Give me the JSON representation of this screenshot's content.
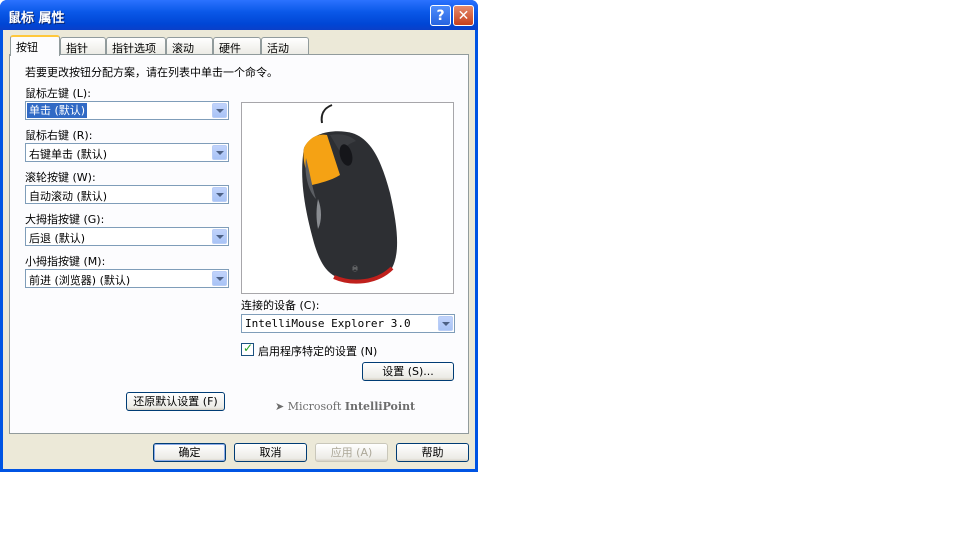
{
  "window": {
    "title": "鼠标 属性",
    "help_symbol": "?",
    "close_symbol": "✕"
  },
  "tabs": [
    {
      "label": "按钮",
      "active": true
    },
    {
      "label": "指针"
    },
    {
      "label": "指针选项"
    },
    {
      "label": "滚动"
    },
    {
      "label": "硬件"
    },
    {
      "label": "活动"
    }
  ],
  "panel": {
    "instruction": "若要更改按钮分配方案，请在列表中单击一个命令。",
    "fields": [
      {
        "label": "鼠标左键 (L):",
        "value": "单击 (默认)"
      },
      {
        "label": "鼠标右键 (R):",
        "value": "右键单击 (默认)"
      },
      {
        "label": "滚轮按键 (W):",
        "value": "自动滚动 (默认)"
      },
      {
        "label": "大拇指按键 (G):",
        "value": "后退 (默认)"
      },
      {
        "label": "小拇指按键 (M):",
        "value": "前进 (浏览器) (默认)"
      }
    ],
    "device_label": "连接的设备 (C):",
    "device_value": "IntelliMouse Explorer 3.0",
    "app_specific_label": "启用程序特定的设置 (N)",
    "app_specific_checked": true,
    "settings_button": "设置 (S)...",
    "restore_button": "还原默认设置 (F)",
    "brand_prefix": "Microsoft",
    "brand_name": "IntelliPoint",
    "highlight_color": "#f5a214"
  },
  "buttons": {
    "ok": "确定",
    "cancel": "取消",
    "apply": "应用 (A)",
    "help": "帮助"
  }
}
